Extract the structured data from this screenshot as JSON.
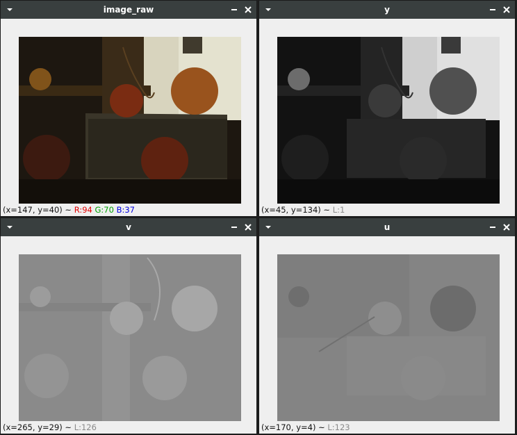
{
  "windows": {
    "image_raw": {
      "title": "image_raw",
      "coords": "(x=147, y=40) ~",
      "r": "R:94",
      "g": "G:70",
      "b": "B:37"
    },
    "y": {
      "title": "y",
      "coords": "(x=45, y=134) ~",
      "l": "L:1"
    },
    "v": {
      "title": "v",
      "coords": "(x=265, y=29) ~",
      "l": "L:126"
    },
    "u": {
      "title": "u",
      "coords": "(x=170, y=4) ~",
      "l": "L:123"
    }
  },
  "icons": {
    "menu": "menu-arrow-icon",
    "minimize": "minimize-icon",
    "close": "close-icon"
  },
  "colors": {
    "titlebar": "#393f3f",
    "window_bg": "#efefef",
    "r_value": "#e30000",
    "g_value": "#00a000",
    "b_value": "#0000e0",
    "l_value": "#8a8a8a"
  }
}
